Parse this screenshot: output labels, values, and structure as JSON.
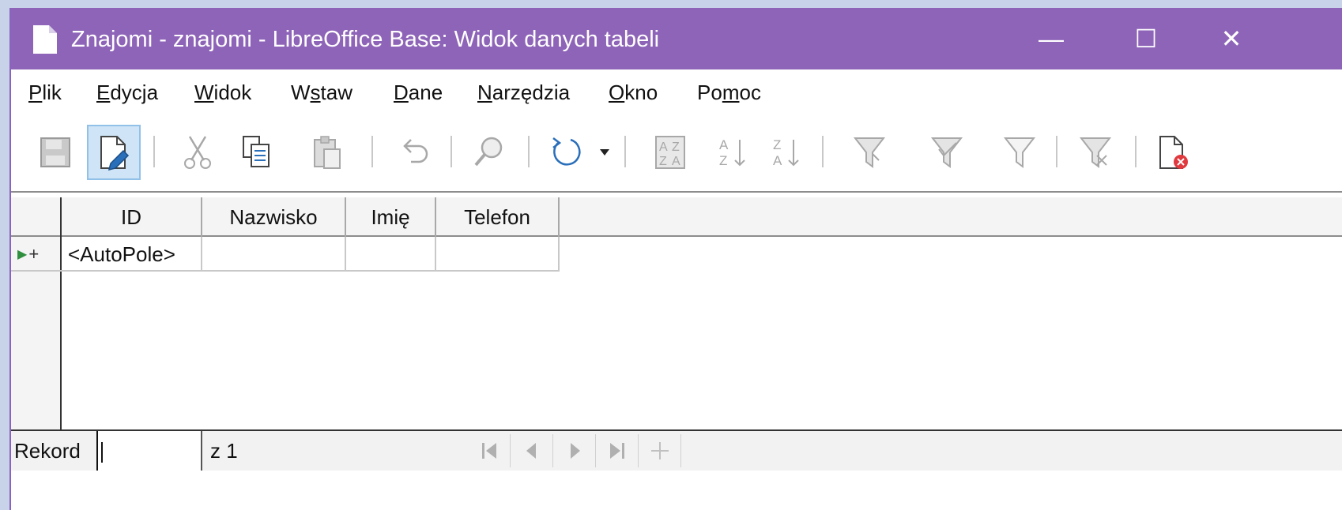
{
  "window": {
    "title": "Znajomi - znajomi - LibreOffice Base: Widok danych tabeli",
    "controls": {
      "minimize": "—",
      "maximize": "☐",
      "close": "✕"
    },
    "titlebar_color": "#8e64b8"
  },
  "menu": {
    "items": [
      {
        "label": "Plik",
        "mnemonic_index": 0
      },
      {
        "label": "Edycja",
        "mnemonic_index": 0
      },
      {
        "label": "Widok",
        "mnemonic_index": 0
      },
      {
        "label": "Wstaw",
        "mnemonic_index": 1
      },
      {
        "label": "Dane",
        "mnemonic_index": 0
      },
      {
        "label": "Narzędzia",
        "mnemonic_index": 0
      },
      {
        "label": "Okno",
        "mnemonic_index": 0
      },
      {
        "label": "Pomoc",
        "mnemonic_index": 2
      }
    ]
  },
  "toolbar": {
    "buttons": [
      {
        "icon": "save-record-icon",
        "enabled": false
      },
      {
        "icon": "edit-data-icon",
        "enabled": true,
        "active": true
      },
      {
        "icon": "cut-icon",
        "enabled": false
      },
      {
        "icon": "copy-icon",
        "enabled": true
      },
      {
        "icon": "paste-icon",
        "enabled": false
      },
      {
        "icon": "undo-icon",
        "enabled": false
      },
      {
        "icon": "find-record-icon",
        "enabled": false
      },
      {
        "icon": "refresh-icon",
        "enabled": true
      },
      {
        "icon": "sort-icon",
        "enabled": false
      },
      {
        "icon": "sort-ascending-icon",
        "enabled": false
      },
      {
        "icon": "sort-descending-icon",
        "enabled": false
      },
      {
        "icon": "autofilter-icon",
        "enabled": false
      },
      {
        "icon": "apply-filter-icon",
        "enabled": false
      },
      {
        "icon": "standard-filter-icon",
        "enabled": false
      },
      {
        "icon": "reset-filter-icon",
        "enabled": false
      },
      {
        "icon": "delete-record-icon",
        "enabled": true
      }
    ]
  },
  "table": {
    "columns": [
      "ID",
      "Nazwisko",
      "Imię",
      "Telefon"
    ],
    "rows": [
      {
        "marker": "+",
        "cells": [
          "<AutoPole>",
          "",
          "",
          ""
        ]
      }
    ]
  },
  "navigation": {
    "record_label": "Rekord",
    "record_value": "",
    "of_text": "z 1",
    "buttons": [
      "first-record-icon",
      "previous-record-icon",
      "next-record-icon",
      "last-record-icon",
      "new-record-icon"
    ]
  }
}
